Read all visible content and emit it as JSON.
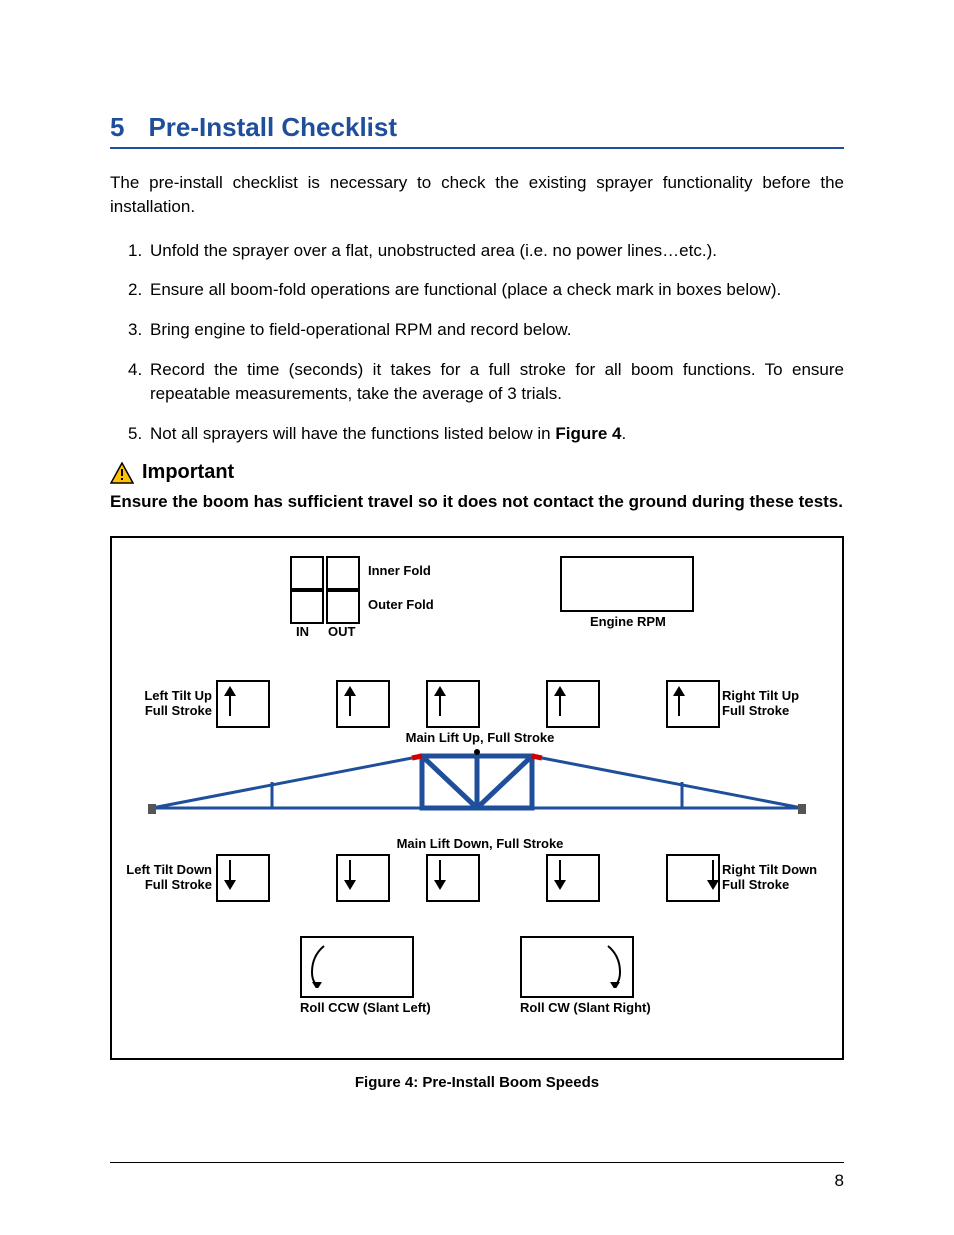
{
  "colors": {
    "brand": "#1F4E9B"
  },
  "heading": {
    "number": "5",
    "title": "Pre-Install Checklist"
  },
  "intro": "The pre-install checklist is necessary to check the existing sprayer functionality before the installation.",
  "steps": [
    "Unfold the sprayer over a flat, unobstructed area (i.e. no power lines…etc.).",
    "Ensure all boom-fold operations are functional (place a check mark in boxes below).",
    "Bring engine to field-operational RPM and record below.",
    "Record the time (seconds) it takes for a full stroke for all boom functions.  To ensure repeatable measurements, take the average of 3 trials."
  ],
  "step5_prefix": "Not all sprayers will have the functions listed below in ",
  "step5_bold": "Figure 4",
  "step5_suffix": ".",
  "important": {
    "label": "Important",
    "text": "Ensure the boom has sufficient travel so it does not contact the ground during these tests."
  },
  "diagram": {
    "inner_fold": "Inner Fold",
    "outer_fold": "Outer Fold",
    "in": "IN",
    "out": "OUT",
    "engine_rpm": "Engine RPM",
    "left_tilt_up_l1": "Left Tilt Up",
    "left_tilt_up_l2": "Full Stroke",
    "right_tilt_up_l1": "Right Tilt Up",
    "right_tilt_up_l2": "Full Stroke",
    "main_up": "Main Lift Up, Full Stroke",
    "main_down": "Main Lift Down, Full Stroke",
    "left_tilt_down_l1": "Left Tilt Down",
    "left_tilt_down_l2": "Full Stroke",
    "right_tilt_down_l1": "Right Tilt  Down",
    "right_tilt_down_l2": "Full Stroke",
    "roll_ccw": "Roll CCW (Slant Left)",
    "roll_cw": "Roll CW (Slant Right)"
  },
  "figure_caption": "Figure 4: Pre-Install Boom Speeds",
  "page_number": "8"
}
